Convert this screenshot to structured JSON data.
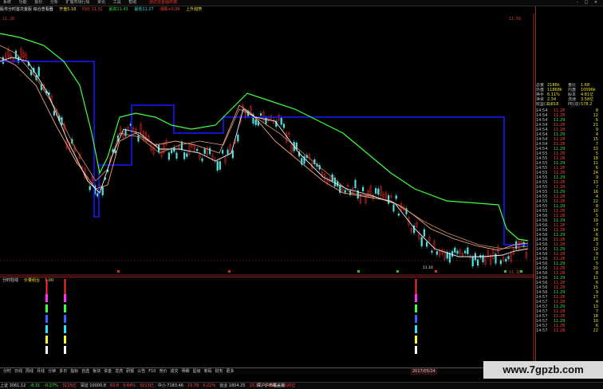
{
  "menu": {
    "items": [
      "系统",
      "功能",
      "报价",
      "分析",
      "扩展市场行情",
      "资讯",
      "工具",
      "帮助"
    ],
    "brand": "通达信金融终端",
    "window_buttons": "- □ ×"
  },
  "infobar": {
    "title": "股市分时首次金股 综合查看器",
    "f1": "开盘5.18",
    "f2": "均价 11.32",
    "f3": "最高11.43",
    "f4": "最低11.27",
    "f5": "涨跌+0.06",
    "f6": "上升趋势"
  },
  "chart": {
    "price_label": "11.28",
    "axis_right_top": "11.58",
    "axis_right_bottom": "11.16",
    "low_label": "11.16"
  },
  "subchart": {
    "title": "分时柱线",
    "params": "价量组合",
    "val": "1.00"
  },
  "rightpanel": {
    "summary": [
      {
        "k": "总量",
        "v": "2186k",
        "k2": "量比",
        "v2": "1.68"
      },
      {
        "k": "外盘",
        "v": "11868k",
        "k2": "内盘",
        "v2": "10096k"
      },
      {
        "k": "换手",
        "v": "6.11%",
        "k2": "股本",
        "v2": "4.81亿"
      },
      {
        "k": "净资",
        "v": "2.34",
        "k2": "流通",
        "v2": "3.58亿"
      },
      {
        "k": "收益(三)",
        "v": "0.818",
        "k2": "PE(动)",
        "v2": "578.2"
      }
    ],
    "ticks": [
      {
        "t": "14:54",
        "p": "11.28",
        "v": "8"
      },
      {
        "t": "14:54",
        "p": "11.28",
        "v": "12"
      },
      {
        "t": "14:54",
        "p": "11.29",
        "v": "6"
      },
      {
        "t": "14:54",
        "p": "11.28",
        "v": "21"
      },
      {
        "t": "14:54",
        "p": "11.28",
        "v": "9"
      },
      {
        "t": "14:54",
        "p": "11.29",
        "v": "4"
      },
      {
        "t": "14:54",
        "p": "11.28",
        "v": "15"
      },
      {
        "t": "14:54",
        "p": "11.28",
        "v": "7"
      },
      {
        "t": "14:54",
        "p": "11.29",
        "v": "33"
      },
      {
        "t": "14:55",
        "p": "11.28",
        "v": "5"
      },
      {
        "t": "14:55",
        "p": "11.28",
        "v": "18"
      },
      {
        "t": "14:55",
        "p": "11.29",
        "v": "11"
      },
      {
        "t": "14:55",
        "p": "11.28",
        "v": "6"
      },
      {
        "t": "14:55",
        "p": "11.28",
        "v": "24"
      },
      {
        "t": "14:55",
        "p": "11.29",
        "v": "9"
      },
      {
        "t": "14:55",
        "p": "11.28",
        "v": "13"
      },
      {
        "t": "14:55",
        "p": "11.28",
        "v": "7"
      },
      {
        "t": "14:55",
        "p": "11.29",
        "v": "16"
      },
      {
        "t": "14:55",
        "p": "11.28",
        "v": "4"
      },
      {
        "t": "14:55",
        "p": "11.28",
        "v": "22"
      },
      {
        "t": "14:55",
        "p": "11.29",
        "v": "8"
      },
      {
        "t": "14:55",
        "p": "11.28",
        "v": "10"
      },
      {
        "t": "14:56",
        "p": "11.28",
        "v": "5"
      },
      {
        "t": "14:56",
        "p": "11.29",
        "v": "19"
      },
      {
        "t": "14:56",
        "p": "11.28",
        "v": "7"
      },
      {
        "t": "14:56",
        "p": "11.28",
        "v": "14"
      },
      {
        "t": "14:56",
        "p": "11.29",
        "v": "6"
      },
      {
        "t": "14:56",
        "p": "11.28",
        "v": "28"
      },
      {
        "t": "14:56",
        "p": "11.28",
        "v": "3"
      },
      {
        "t": "14:56",
        "p": "11.29",
        "v": "12"
      },
      {
        "t": "14:56",
        "p": "11.28",
        "v": "9"
      },
      {
        "t": "14:56",
        "p": "11.28",
        "v": "17"
      },
      {
        "t": "14:56",
        "p": "11.29",
        "v": "5"
      },
      {
        "t": "14:56",
        "p": "11.28",
        "v": "20"
      },
      {
        "t": "14:56",
        "p": "11.28",
        "v": "8"
      },
      {
        "t": "14:56",
        "p": "11.29",
        "v": "11"
      },
      {
        "t": "14:56",
        "p": "11.28",
        "v": "6"
      },
      {
        "t": "14:56",
        "p": "11.28",
        "v": "15"
      },
      {
        "t": "14:56",
        "p": "11.29",
        "v": "9"
      },
      {
        "t": "14:57",
        "p": "11.28",
        "v": "27"
      },
      {
        "t": "14:57",
        "p": "11.28",
        "v": "4"
      },
      {
        "t": "14:57",
        "p": "11.29",
        "v": "13"
      },
      {
        "t": "14:57",
        "p": "11.28",
        "v": "7"
      },
      {
        "t": "14:57",
        "p": "11.28",
        "v": "18"
      },
      {
        "t": "14:57",
        "p": "11.29",
        "v": "10"
      },
      {
        "t": "14:57",
        "p": "11.28",
        "v": "6"
      },
      {
        "t": "14:57",
        "p": "11.28",
        "v": "22"
      }
    ]
  },
  "tabs": {
    "items": [
      "分时",
      "日线",
      "周线",
      "月线",
      "分钟",
      "多日",
      "指标",
      "自选",
      "板块",
      "资金",
      "龙虎",
      "研报",
      "公告",
      "F10",
      "竞价",
      "成交",
      "明细",
      "星级",
      "筹码",
      "财务",
      "更多"
    ],
    "right_label": "2017/05/24"
  },
  "statusbar": {
    "items": [
      "上证 3061.12",
      "-8.31",
      "-0.27%",
      "3125亿",
      "深证 10000.8",
      "63.8",
      "0.64%",
      "3213亿",
      "中小 7183.46",
      "15.78",
      "0.22%",
      "创业 1804.25",
      "15.97",
      "0.89%",
      "1520亿"
    ],
    "right": "深沪沪市覆盖版"
  },
  "watermark": "www.7gpzb.com",
  "colors": {
    "up": "#ff3030",
    "down": "#50e0e0",
    "ma_green": "#40ff40",
    "ma_white": "#f0f0f0",
    "ma_salmon": "#f0a080",
    "ma_tan": "#d09060",
    "step_blue": "#1818ff"
  }
}
